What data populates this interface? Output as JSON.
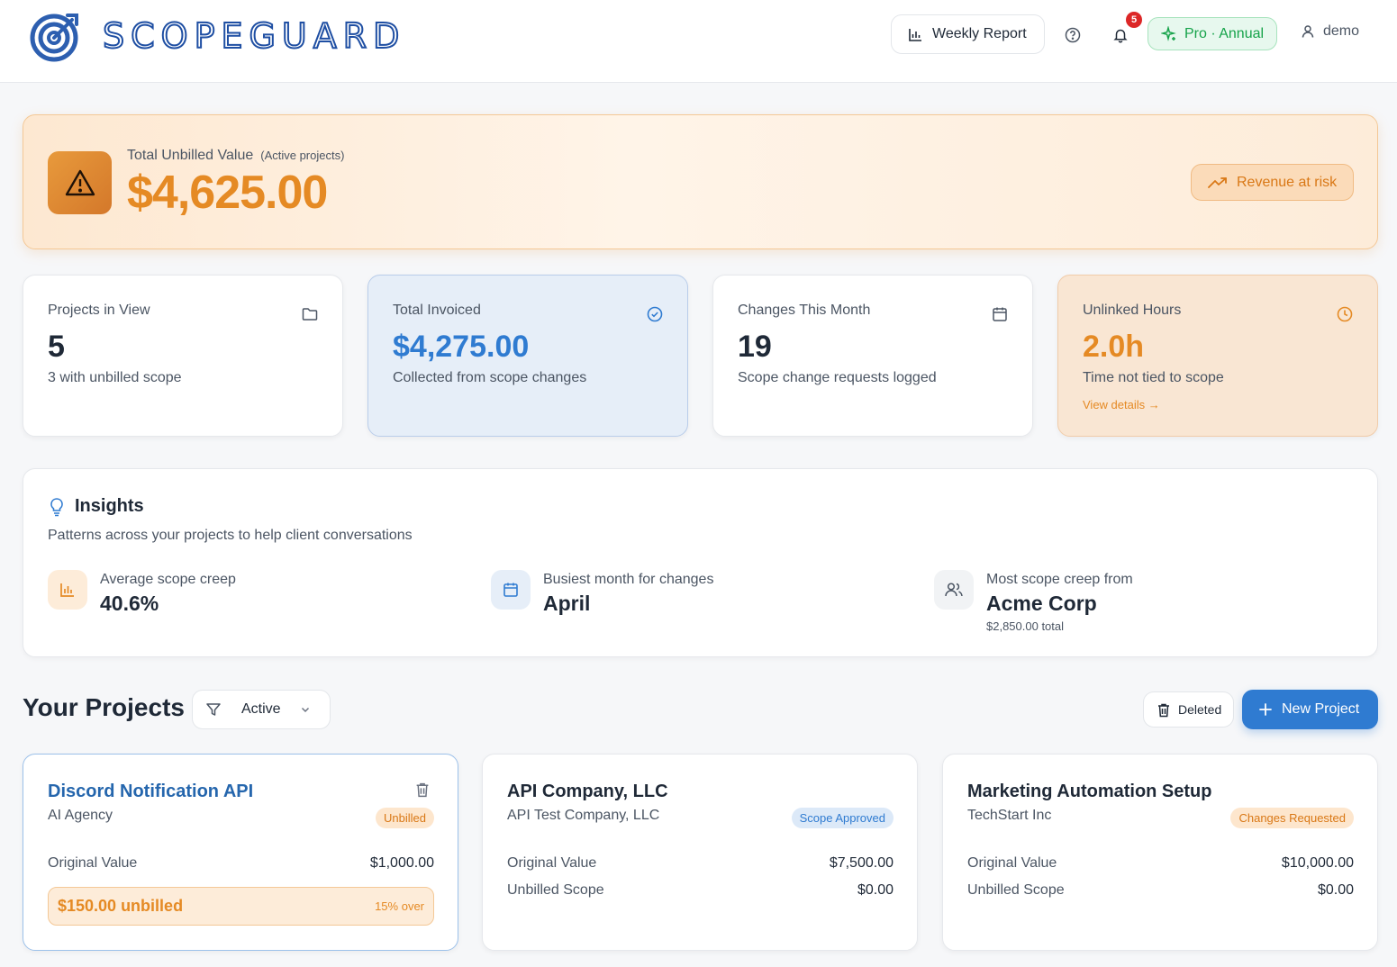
{
  "header": {
    "brand": "SCOPEGUARD",
    "weekly_report": "Weekly Report",
    "notification_count": "5",
    "plan": "Pro · Annual",
    "user": "demo"
  },
  "banner": {
    "label": "Total Unbilled Value",
    "qualifier": "(Active projects)",
    "value": "$4,625.00",
    "risk_button": "Revenue at risk"
  },
  "stats": [
    {
      "label": "Projects in View",
      "value": "5",
      "sub": "3 with unbilled scope",
      "icon": "folder-icon"
    },
    {
      "label": "Total Invoiced",
      "value": "$4,275.00",
      "sub": "Collected from scope changes",
      "icon": "check-circle-icon"
    },
    {
      "label": "Changes This Month",
      "value": "19",
      "sub": "Scope change requests logged",
      "icon": "calendar-icon"
    },
    {
      "label": "Unlinked Hours",
      "value": "2.0h",
      "sub": "Time not tied to scope",
      "link": "View details →",
      "icon": "clock-icon"
    }
  ],
  "insights": {
    "title": "Insights",
    "subtitle": "Patterns across your projects to help client conversations",
    "items": [
      {
        "label": "Average scope creep",
        "value": "40.6%",
        "icon": "bar-chart-icon"
      },
      {
        "label": "Busiest month for changes",
        "value": "April",
        "icon": "calendar-icon"
      },
      {
        "label": "Most scope creep from",
        "value": "Acme Corp",
        "note": "$2,850.00 total",
        "icon": "users-icon"
      }
    ]
  },
  "projects": {
    "title": "Your Projects",
    "filter_value": "Active",
    "deleted_label": "Deleted",
    "new_label": "New Project",
    "cards": [
      {
        "name": "Discord Notification API",
        "client": "AI Agency",
        "status": "Unbilled",
        "original_label": "Original Value",
        "original_value": "$1,000.00",
        "unbilled_amount": "$150.00 unbilled",
        "unbilled_pct": "15% over"
      },
      {
        "name": "API Company, LLC",
        "client": "API Test Company, LLC",
        "status": "Scope Approved",
        "original_label": "Original Value",
        "original_value": "$7,500.00",
        "unbilled_label": "Unbilled Scope",
        "unbilled_value": "$0.00"
      },
      {
        "name": "Marketing Automation Setup",
        "client": "TechStart Inc",
        "status": "Changes Requested",
        "original_label": "Original Value",
        "original_value": "$10,000.00",
        "unbilled_label": "Unbilled Scope",
        "unbilled_value": "$0.00"
      }
    ]
  }
}
